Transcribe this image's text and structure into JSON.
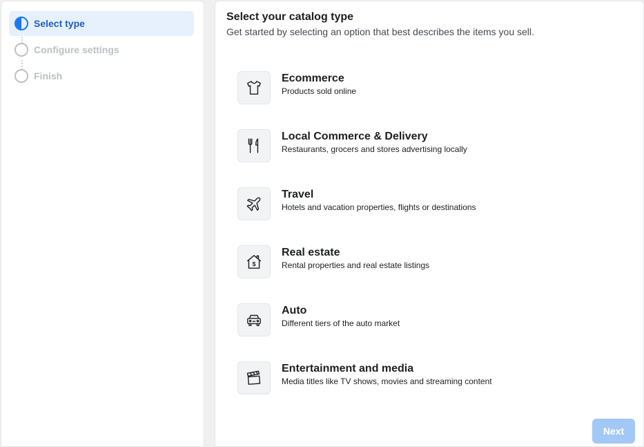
{
  "sidebar": {
    "steps": [
      {
        "label": "Select type",
        "state": "active"
      },
      {
        "label": "Configure settings",
        "state": "pending"
      },
      {
        "label": "Finish",
        "state": "pending"
      }
    ]
  },
  "main": {
    "title": "Select your catalog type",
    "subtitle": "Get started by selecting an option that best describes the items you sell.",
    "options": [
      {
        "title": "Ecommerce",
        "description": "Products sold online",
        "icon": "tshirt-icon"
      },
      {
        "title": "Local Commerce & Delivery",
        "description": "Restaurants, grocers and stores advertising locally",
        "icon": "fork-knife-icon"
      },
      {
        "title": "Travel",
        "description": "Hotels and vacation properties, flights or destinations",
        "icon": "airplane-icon"
      },
      {
        "title": "Real estate",
        "description": "Rental properties and real estate listings",
        "icon": "house-dollar-icon"
      },
      {
        "title": "Auto",
        "description": "Different tiers of the auto market",
        "icon": "car-icon"
      },
      {
        "title": "Entertainment and media",
        "description": "Media titles like TV shows, movies and streaming content",
        "icon": "clapperboard-icon"
      }
    ],
    "next_label": "Next"
  },
  "colors": {
    "accent": "#1877f2",
    "active_step_bg": "#e7f0fd",
    "disabled_button": "#a3c8f6"
  }
}
